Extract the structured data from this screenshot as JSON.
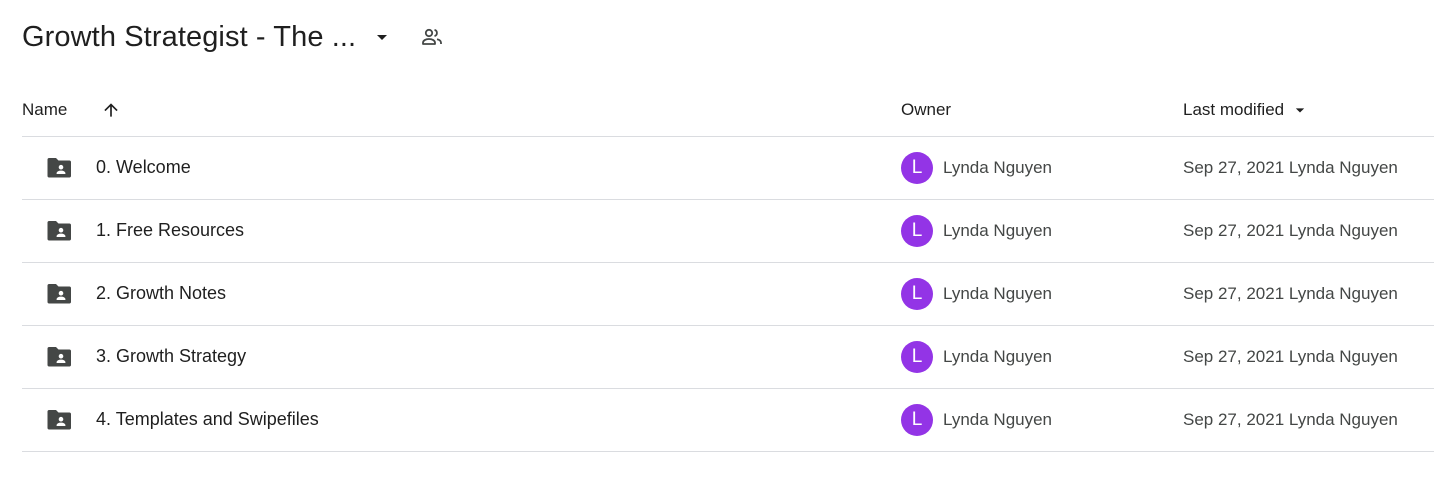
{
  "header": {
    "title": "Growth Strategist - The ...",
    "dropdown_icon": "arrow-drop-down-icon",
    "shared_icon": "shared-people-icon"
  },
  "columns": {
    "name": "Name",
    "owner": "Owner",
    "last_modified": "Last modified",
    "sort_icon": "arrow-upward-icon",
    "sort_caret_icon": "arrow-drop-down-icon"
  },
  "items": [
    {
      "name": "0. Welcome",
      "icon": "shared-folder-icon",
      "owner_initial": "L",
      "owner": "Lynda Nguyen",
      "modified": "Sep 27, 2021 Lynda Nguyen"
    },
    {
      "name": "1. Free Resources",
      "icon": "shared-folder-icon",
      "owner_initial": "L",
      "owner": "Lynda Nguyen",
      "modified": "Sep 27, 2021 Lynda Nguyen"
    },
    {
      "name": "2. Growth Notes",
      "icon": "shared-folder-icon",
      "owner_initial": "L",
      "owner": "Lynda Nguyen",
      "modified": "Sep 27, 2021 Lynda Nguyen"
    },
    {
      "name": "3. Growth Strategy",
      "icon": "shared-folder-icon",
      "owner_initial": "L",
      "owner": "Lynda Nguyen",
      "modified": "Sep 27, 2021 Lynda Nguyen"
    },
    {
      "name": "4. Templates and Swipefiles",
      "icon": "shared-folder-icon",
      "owner_initial": "L",
      "owner": "Lynda Nguyen",
      "modified": "Sep 27, 2021 Lynda Nguyen"
    }
  ],
  "colors": {
    "avatar": "#9334e6",
    "folder_icon": "#444746",
    "divider": "#dadce0",
    "text_primary": "#1f1f1f",
    "text_secondary": "#444746"
  }
}
